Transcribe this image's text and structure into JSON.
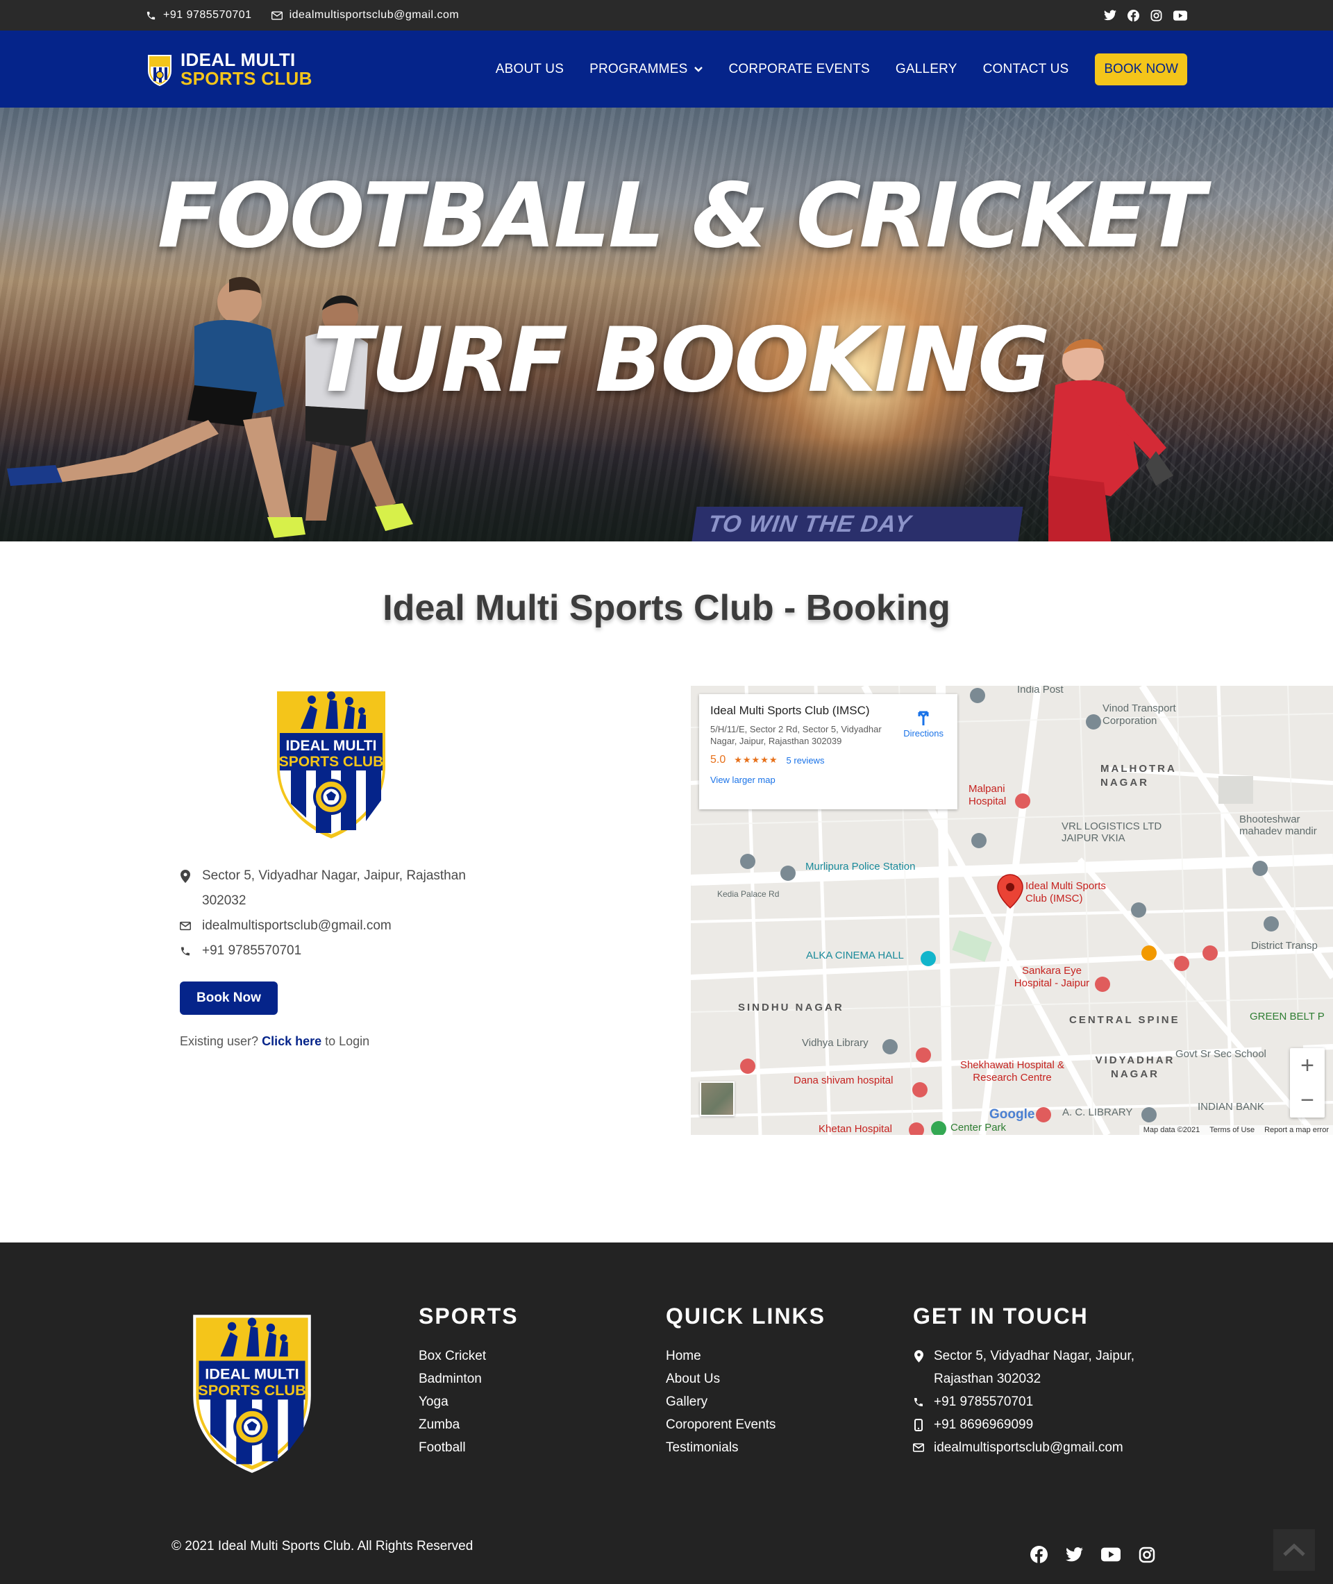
{
  "topbar": {
    "phone": "+91 9785570701",
    "email": "idealmultisportsclub@gmail.com",
    "social": [
      "twitter-icon",
      "facebook-icon",
      "instagram-icon",
      "youtube-icon"
    ]
  },
  "header": {
    "brand_line1": "IDEAL MULTI",
    "brand_line2": "SPORTS CLUB",
    "nav": [
      {
        "label": "ABOUT US"
      },
      {
        "label": "PROGRAMMES"
      },
      {
        "label": "CORPORATE EVENTS"
      },
      {
        "label": "GALLERY"
      },
      {
        "label": "CONTACT US"
      }
    ],
    "book_now": "BOOK NOW"
  },
  "hero": {
    "line1": "FOOTBALL & CRICKET",
    "line2": "TURF BOOKING",
    "banner": "TO WIN THE DAY"
  },
  "booking": {
    "title": "Ideal Multi Sports Club - Booking",
    "logo_line1": "IDEAL MULTI",
    "logo_line2": "SPORTS CLUB",
    "address": "Sector 5, Vidyadhar Nagar, Jaipur, Rajasthan 302032",
    "email": "idealmultisportsclub@gmail.com",
    "phone": "+91 9785570701",
    "button": "Book Now",
    "existing_prefix": "Existing user?",
    "existing_link": "Click here",
    "existing_suffix": "to Login"
  },
  "map": {
    "card_title": "Ideal Multi Sports Club (IMSC)",
    "card_address": "5/H/11/E, Sector 2 Rd, Sector 5, Vidyadhar Nagar, Jaipur, Rajasthan 302039",
    "rating": "5.0",
    "stars": "★★★★★",
    "reviews": "5 reviews",
    "larger_map": "View larger map",
    "directions": "Directions",
    "pin_label": "Ideal Multi Sports Club (IMSC)",
    "labels": {
      "police": "Murlipura Police Station",
      "malpani": "Malpani Hospital",
      "vrl": "VRL LOGISTICS LTD JAIPUR VKIA",
      "malhotra": "MALHOTRA NAGAR",
      "bhooteshwar": "Bhooteshwar mahadev mandir",
      "vinod": "Vinod Transport Corporation",
      "alka": "ALKA CINEMA HALL",
      "sankara": "Sankara Eye Hospital - Jaipur",
      "sindhu": "SINDHU NAGAR",
      "central": "CENTRAL SPINE",
      "vidyadhar": "VIDYADHAR NAGAR",
      "shekhawati": "Shekhawati Hospital & Research Centre",
      "dana": "Dana shivam hospital",
      "khetan": "Khetan Hospital",
      "center_park": "Center Park",
      "library": "A. C. LIBRARY",
      "indian_bank": "INDIAN BANK",
      "green_belt": "GREEN BELT P",
      "district": "District Transp",
      "govt": "Govt Sr Sec School",
      "vidhya": "Vidhya Library",
      "kedia": "Kedia Palace Rd",
      "india_post": "India Post"
    },
    "google": "Google",
    "map_data": "Map data ©2021",
    "terms": "Terms of Use",
    "report": "Report a map error"
  },
  "footer": {
    "logo_line1": "IDEAL MULTI",
    "logo_line2": "SPORTS CLUB",
    "sports_title": "SPORTS",
    "sports": [
      "Box Cricket",
      "Badminton",
      "Yoga",
      "Zumba",
      "Football"
    ],
    "quick_title": "QUICK LINKS",
    "quick": [
      "Home",
      "About Us",
      "Gallery",
      "Coroporent Events",
      "Testimonials"
    ],
    "touch_title": "GET IN TOUCH",
    "address_line1": "Sector 5, Vidyadhar Nagar, Jaipur,",
    "address_line2": "Rajasthan 302032",
    "phone": "+91 9785570701",
    "mobile": "+91 8696969099",
    "email": "idealmultisportsclub@gmail.com",
    "copyright": "© 2021 Ideal Multi Sports Club. All Rights Reserved"
  },
  "colors": {
    "navy": "#05248a",
    "gold": "#f4c51a",
    "dark": "#232323"
  }
}
